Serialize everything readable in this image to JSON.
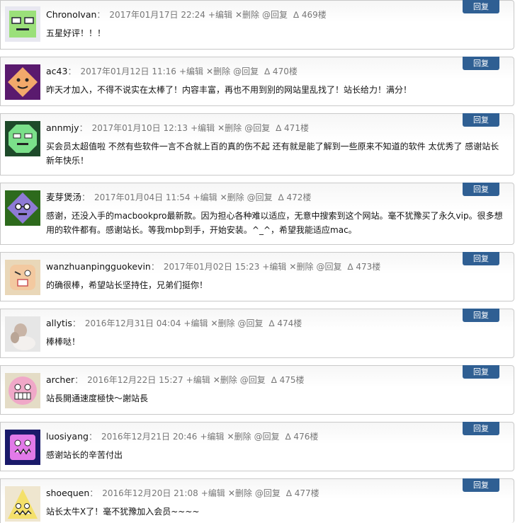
{
  "labels": {
    "reply_button": "回复",
    "edit": "+编辑",
    "delete": "✕删除",
    "reply": "@回复"
  },
  "comments": [
    {
      "author": "ChronoIvan",
      "time": "2017年01月17日 22:24",
      "floor": "∆ 469楼",
      "text": "五星好评！！！",
      "avatar": "avatar-green-square-face"
    },
    {
      "author": "ac43",
      "time": "2017年01月12日 11:16",
      "floor": "∆ 470楼",
      "text": "昨天才加入，不得不说实在太棒了！内容丰富，再也不用到别的网站里乱找了！站长给力！满分！",
      "avatar": "avatar-purple-diamond-face"
    },
    {
      "author": "annmjy",
      "time": "2017年01月10日 12:13",
      "floor": "∆ 471楼",
      "text": "买会员太超值啦 不然有些软件一言不合就上百的真的伤不起 还有就是能了解到一些原来不知道的软件 太优秀了 感谢站长 新年快乐！",
      "avatar": "avatar-green-octagon-face"
    },
    {
      "author": "麦芽煲汤",
      "time": "2017年01月04日 11:54",
      "floor": "∆ 472楼",
      "text": "感谢，还没入手的macbookpro最新款。因为担心各种难以适应，无意中搜索到这个网站。毫不犹豫买了永久vip。很多想用的软件都有。感谢站长。等我mbp到手，开始安装。^_^，希望我能适应mac。",
      "avatar": "avatar-purple-diamond-glasses"
    },
    {
      "author": "wanzhuanpingguokevin",
      "time": "2017年01月02日 15:23",
      "floor": "∆ 473楼",
      "text": "的确很棒，希望站长坚持住，兄弟们挺你！",
      "avatar": "avatar-beige-bandaged-face"
    },
    {
      "author": "allytis",
      "time": "2016年12月31日 04:04",
      "floor": "∆ 474楼",
      "text": "棒棒哒！",
      "avatar": "avatar-photo"
    },
    {
      "author": "archer",
      "time": "2016年12月22日 15:27",
      "floor": "∆ 475楼",
      "text": "站長開通速度極快～謝站長",
      "avatar": "avatar-pink-grin-face"
    },
    {
      "author": "luosiyang",
      "time": "2016年12月21日 20:46",
      "floor": "∆ 476楼",
      "text": "感谢站长的辛苦付出",
      "avatar": "avatar-magenta-monster-face"
    },
    {
      "author": "shoequen",
      "time": "2016年12月20日 21:08",
      "floor": "∆ 477楼",
      "text": "站长太牛X了！毫不犹豫加入会员~~~~",
      "avatar": "avatar-yellow-triangle-face"
    }
  ]
}
